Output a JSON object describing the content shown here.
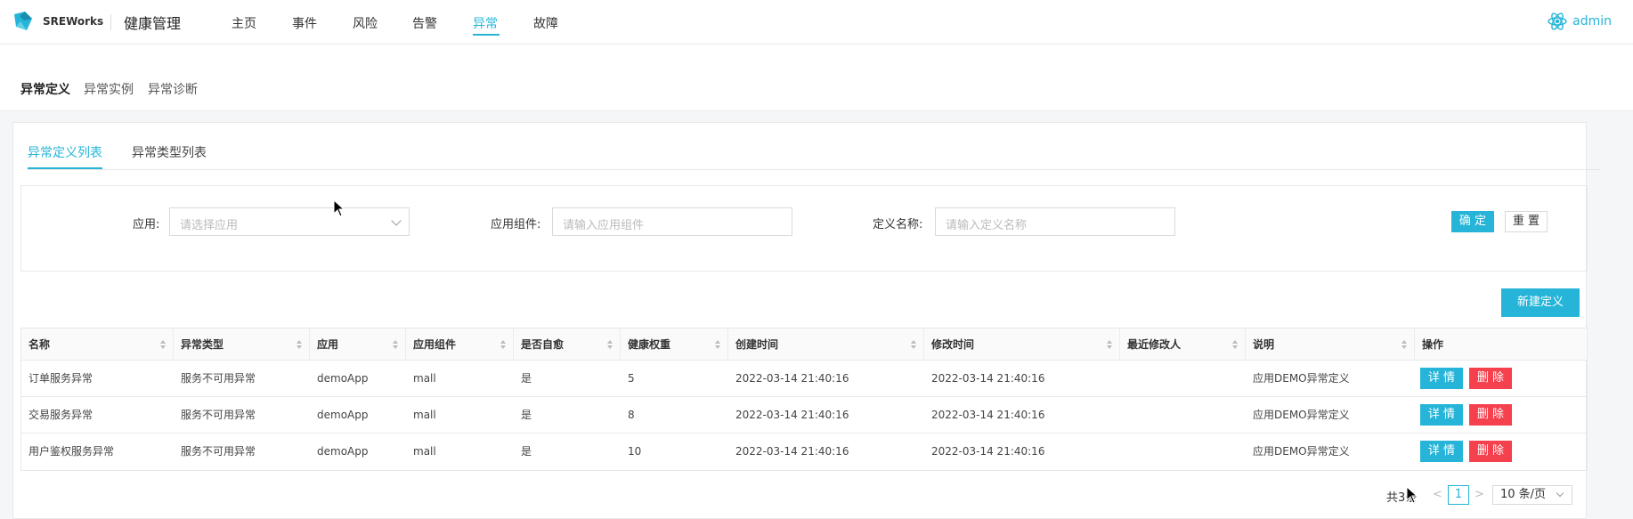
{
  "header": {
    "brand": "SREWorks",
    "product": "健康管理",
    "nav": [
      {
        "label": "主页"
      },
      {
        "label": "事件"
      },
      {
        "label": "风险"
      },
      {
        "label": "告警"
      },
      {
        "label": "异常",
        "active": true
      },
      {
        "label": "故障"
      }
    ],
    "user": "admin"
  },
  "subnav": [
    {
      "label": "异常定义",
      "active": true
    },
    {
      "label": "异常实例"
    },
    {
      "label": "异常诊断"
    }
  ],
  "tabs": [
    {
      "label": "异常定义列表",
      "active": true
    },
    {
      "label": "异常类型列表"
    }
  ],
  "filter": {
    "app_label": "应用:",
    "app_placeholder": "请选择应用",
    "component_label": "应用组件:",
    "component_placeholder": "请输入应用组件",
    "name_label": "定义名称:",
    "name_placeholder": "请输入定义名称",
    "confirm": "确 定",
    "reset": "重 置"
  },
  "new_button": "新建定义",
  "table": {
    "columns": [
      "名称",
      "异常类型",
      "应用",
      "应用组件",
      "是否自愈",
      "健康权重",
      "创建时间",
      "修改时间",
      "最近修改人",
      "说明",
      "操作"
    ],
    "rows": [
      {
        "name": "订单服务异常",
        "type": "服务不可用异常",
        "app": "demoApp",
        "component": "mall",
        "self_heal": "是",
        "weight": "5",
        "created": "2022-03-14 21:40:16",
        "modified": "2022-03-14 21:40:16",
        "modifier": "",
        "desc": "应用DEMO异常定义"
      },
      {
        "name": "交易服务异常",
        "type": "服务不可用异常",
        "app": "demoApp",
        "component": "mall",
        "self_heal": "是",
        "weight": "8",
        "created": "2022-03-14 21:40:16",
        "modified": "2022-03-14 21:40:16",
        "modifier": "",
        "desc": "应用DEMO异常定义"
      },
      {
        "name": "用户鉴权服务异常",
        "type": "服务不可用异常",
        "app": "demoApp",
        "component": "mall",
        "self_heal": "是",
        "weight": "10",
        "created": "2022-03-14 21:40:16",
        "modified": "2022-03-14 21:40:16",
        "modifier": "",
        "desc": "应用DEMO异常定义"
      }
    ],
    "actions": {
      "detail": "详 情",
      "delete": "删 除"
    }
  },
  "pagination": {
    "total": "共3条",
    "prev": "<",
    "current": "1",
    "next": ">",
    "page_size": "10 条/页"
  },
  "colors": {
    "accent": "#26b5d8",
    "danger": "#f5404e"
  }
}
